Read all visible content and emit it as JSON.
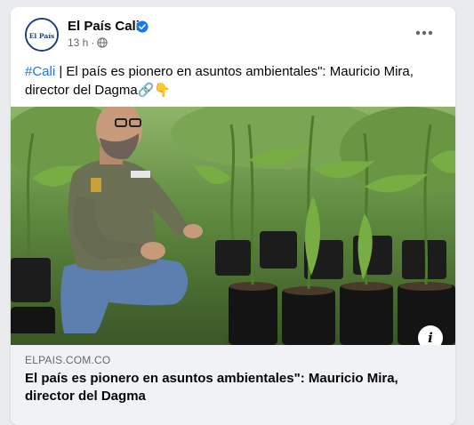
{
  "post": {
    "page_name": "El País Cali",
    "avatar_text": "El País",
    "time": "13 h",
    "separator": "·",
    "caption_hashtag": "#Cali",
    "caption_text": " | El país es pionero en asuntos ambientales\": Mauricio Mira, director del Dagma🔗👇",
    "image_alt": "Man crouching among young potted trees in a nursery",
    "link": {
      "domain": "ELPAIS.COM.CO",
      "title": "El país es pionero en asuntos ambientales\": Mauricio Mira, director del Dagma"
    }
  },
  "icons": {
    "verified": "verified-badge-icon",
    "audience": "globe-icon",
    "more": "more-options-icon",
    "info": "info-icon"
  },
  "colors": {
    "hashtag": "#1b74e4",
    "verified": "#1877f2",
    "brand_navy": "#1f3d7a"
  }
}
